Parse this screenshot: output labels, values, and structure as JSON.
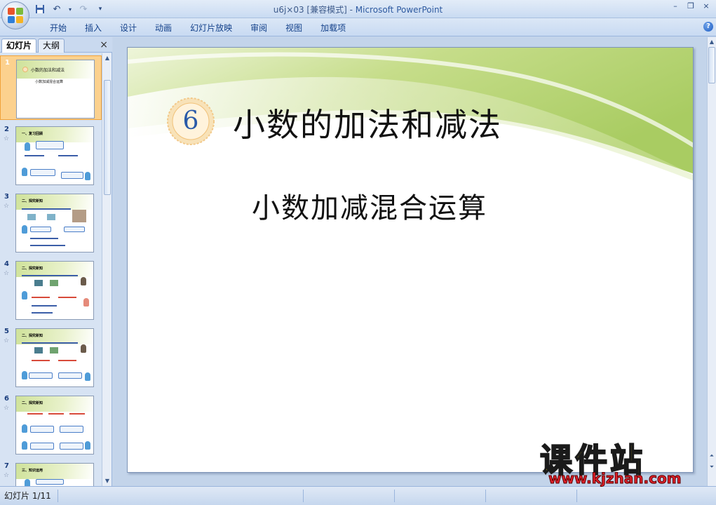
{
  "window": {
    "filename": "u6j×03 [兼容模式]",
    "separator": " - ",
    "app_name": "Microsoft PowerPoint"
  },
  "window_controls": {
    "minimize": "–",
    "restore": "❐",
    "close": "×"
  },
  "quick_access": {
    "save_icon": "save-icon",
    "undo_icon": "undo-icon",
    "redo_icon": "redo-icon",
    "more_icon": "customize-icon"
  },
  "ribbon": {
    "tabs": [
      "开始",
      "插入",
      "设计",
      "动画",
      "幻灯片放映",
      "审阅",
      "视图",
      "加载项"
    ],
    "help": "?"
  },
  "left_pane": {
    "tabs": [
      "幻灯片",
      "大纲"
    ],
    "close": "×",
    "slides": [
      {
        "num": "1",
        "title": "小数的加法和减法",
        "subtitle": "小数加减混合运算"
      },
      {
        "num": "2",
        "title": "一、复习回顾"
      },
      {
        "num": "3",
        "title": "二、探究新知"
      },
      {
        "num": "4",
        "title": "二、探究新知"
      },
      {
        "num": "5",
        "title": "二、探究新知"
      },
      {
        "num": "6",
        "title": "二、探究新知"
      },
      {
        "num": "7",
        "title": "三、知识运用"
      }
    ],
    "star": "☆"
  },
  "slide": {
    "badge_number": "6",
    "title": "小数的加法和减法",
    "subtitle": "小数加减混合运算"
  },
  "status": {
    "text": "幻灯片 1/11"
  },
  "watermark": {
    "brand": "课件站",
    "url": "www.kjzhan.com"
  },
  "colors": {
    "ribbon_text": "#15428b",
    "selected_thumb": "#fcd18e",
    "badge_ring": "#f2c98a",
    "watermark_yellow": "#f5e21e",
    "watermark_red": "#e0202a"
  }
}
